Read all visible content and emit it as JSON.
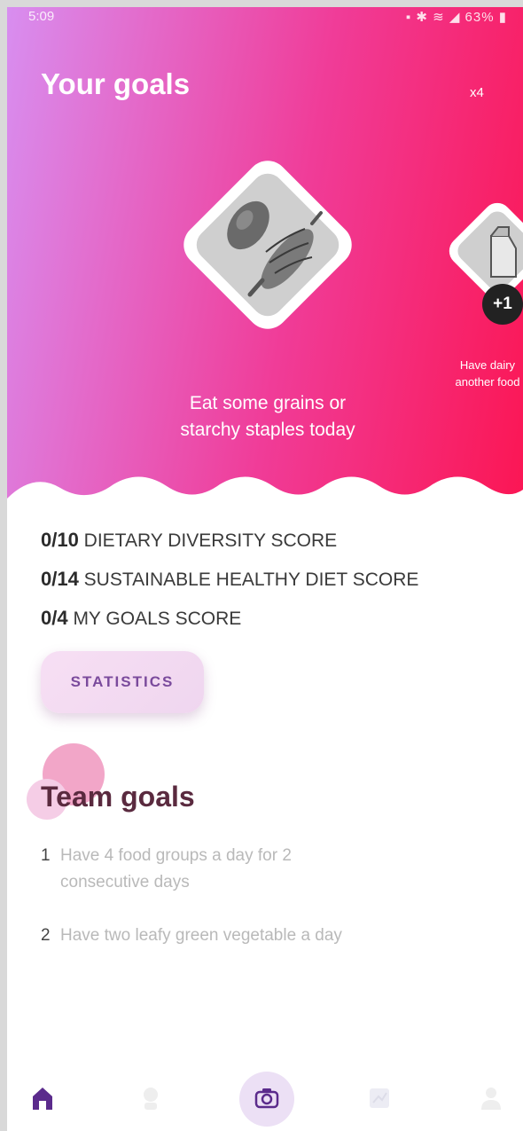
{
  "status_bar": {
    "time": "5:09",
    "battery": "63%"
  },
  "header": {
    "title": "Your goals",
    "multiplier": "x4"
  },
  "goals": [
    {
      "caption_line1": "Eat some grains or",
      "caption_line2": "starchy staples today",
      "icon": "grains-icon"
    },
    {
      "caption_line1": "Have dairy",
      "caption_line2": "another food",
      "badge": "+1",
      "icon": "milk-carton-icon"
    }
  ],
  "scores": [
    {
      "value": "0/10",
      "label": "DIETARY DIVERSITY SCORE"
    },
    {
      "value": "0/14",
      "label": "SUSTAINABLE HEALTHY DIET SCORE"
    },
    {
      "value": "0/4",
      "label": "MY GOALS SCORE"
    }
  ],
  "statistics_button": "STATISTICS",
  "team_goals": {
    "title": "Team goals",
    "items": [
      {
        "number": "1",
        "line1": "Have 4 food groups a day for 2",
        "line2": "consecutive days"
      },
      {
        "number": "2",
        "line1": "Have two leafy green vegetable a day",
        "line2": ""
      }
    ]
  },
  "nav": [
    "home-icon",
    "people-icon",
    "camera-icon",
    "chart-icon",
    "profile-icon"
  ],
  "colors": {
    "gradient_start": "#d88ef0",
    "gradient_end": "#fb1654",
    "accent_purple": "#5b2b8c"
  }
}
